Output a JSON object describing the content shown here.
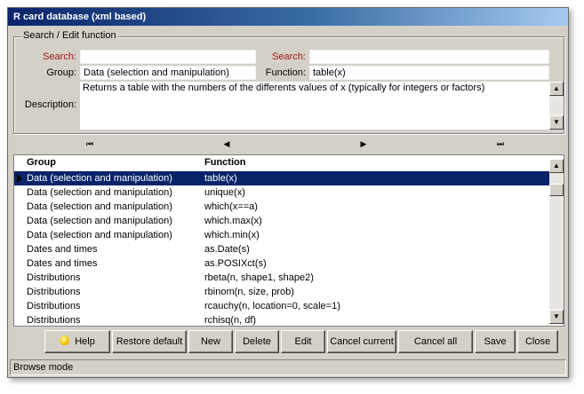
{
  "window": {
    "title": "R card database (xml based)"
  },
  "search_group": {
    "legend": "Search / Edit function",
    "search_label_left": "Search:",
    "search_value_left": "",
    "search_label_right": "Search:",
    "search_value_right": "",
    "group_label": "Group:",
    "group_value": "Data (selection and manipulation)",
    "function_label": "Function:",
    "function_value": "table(x)",
    "description_label": "Description:",
    "description_value": "Returns a table with the numbers of the differents values of x (typically for integers or factors)"
  },
  "navigator": {
    "first": "⏮",
    "prior": "◀",
    "next": "▶",
    "last": "⏭"
  },
  "grid": {
    "columns": [
      "Group",
      "Function"
    ],
    "selected_index": 0,
    "rows": [
      [
        "Data (selection and manipulation)",
        "table(x)"
      ],
      [
        "Data (selection and manipulation)",
        "unique(x)"
      ],
      [
        "Data (selection and manipulation)",
        "which(x==a)"
      ],
      [
        "Data (selection and manipulation)",
        "which.max(x)"
      ],
      [
        "Data (selection and manipulation)",
        "which.min(x)"
      ],
      [
        "Dates and times",
        "as.Date(s)"
      ],
      [
        "Dates and times",
        "as.POSIXct(s)"
      ],
      [
        "Distributions",
        "rbeta(n, shape1, shape2)"
      ],
      [
        "Distributions",
        "rbinom(n, size, prob)"
      ],
      [
        "Distributions",
        "rcauchy(n, location=0, scale=1)"
      ],
      [
        "Distributions",
        "rchisq(n, df)"
      ]
    ]
  },
  "buttons": {
    "help": "Help",
    "restore_default": "Restore default",
    "new": "New",
    "delete": "Delete",
    "edit": "Edit",
    "cancel_current": "Cancel current",
    "cancel_all": "Cancel all",
    "save": "Save",
    "close": "Close"
  },
  "status": {
    "text": "Browse mode"
  },
  "colors": {
    "selection": "#0a246a",
    "title_start": "#0a246a",
    "label_red": "#9b1414",
    "face": "#d4d0c8"
  }
}
